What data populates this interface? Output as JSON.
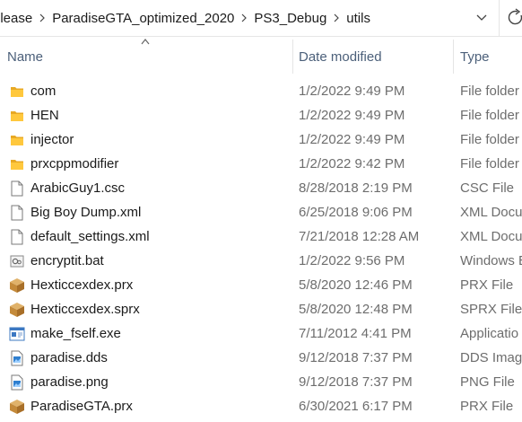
{
  "address": {
    "crumbs": [
      "elease",
      "ParadiseGTA_optimized_2020",
      "PS3_Debug",
      "utils"
    ]
  },
  "columns": {
    "name": "Name",
    "date": "Date modified",
    "type": "Type"
  },
  "files": [
    {
      "name": "com",
      "date": "1/2/2022 9:49 PM",
      "type": "File folder",
      "icon": "folder-icon"
    },
    {
      "name": "HEN",
      "date": "1/2/2022 9:49 PM",
      "type": "File folder",
      "icon": "folder-icon"
    },
    {
      "name": "injector",
      "date": "1/2/2022 9:49 PM",
      "type": "File folder",
      "icon": "folder-icon"
    },
    {
      "name": "prxcppmodifier",
      "date": "1/2/2022 9:42 PM",
      "type": "File folder",
      "icon": "folder-icon"
    },
    {
      "name": "ArabicGuy1.csc",
      "date": "8/28/2018 2:19 PM",
      "type": "CSC File",
      "icon": "document-icon"
    },
    {
      "name": "Big Boy Dump.xml",
      "date": "6/25/2018 9:06 PM",
      "type": "XML Docu",
      "icon": "document-icon"
    },
    {
      "name": "default_settings.xml",
      "date": "7/21/2018 12:28 AM",
      "type": "XML Docu",
      "icon": "document-icon"
    },
    {
      "name": "encryptit.bat",
      "date": "1/2/2022 9:56 PM",
      "type": "Windows B",
      "icon": "batch-file-icon"
    },
    {
      "name": "Hexticcexdex.prx",
      "date": "5/8/2020 12:46 PM",
      "type": "PRX File",
      "icon": "package-icon"
    },
    {
      "name": "Hexticcexdex.sprx",
      "date": "5/8/2020 12:48 PM",
      "type": "SPRX File",
      "icon": "package-icon"
    },
    {
      "name": "make_fself.exe",
      "date": "7/11/2012 4:41 PM",
      "type": "Applicatio",
      "icon": "application-icon"
    },
    {
      "name": "paradise.dds",
      "date": "9/12/2018 7:37 PM",
      "type": "DDS Imag",
      "icon": "image-file-icon"
    },
    {
      "name": "paradise.png",
      "date": "9/12/2018 7:37 PM",
      "type": "PNG File",
      "icon": "image-file-icon"
    },
    {
      "name": "ParadiseGTA.prx",
      "date": "6/30/2021 6:17 PM",
      "type": "PRX File",
      "icon": "package-icon"
    }
  ]
}
